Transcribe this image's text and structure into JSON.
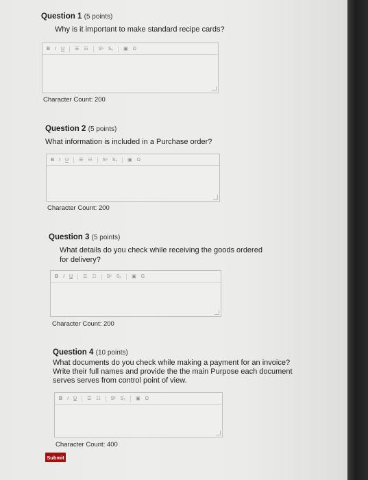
{
  "toolbar": {
    "bold": "B",
    "italic": "I",
    "underline": "U",
    "superscript": "Sˢ",
    "subscript": "S₂",
    "image": "▣",
    "special_char": "Ω"
  },
  "questions": [
    {
      "heading": "Question 1",
      "points": "(5 points)",
      "text": "Why is it important to make standard recipe cards?",
      "count_label": "Character Count: 200"
    },
    {
      "heading": "Question 2",
      "points": "(5 points)",
      "text": "What information is included in a Purchase order?",
      "count_label": "Character Count: 200"
    },
    {
      "heading": "Question 3",
      "points": "(5 points)",
      "text": "What details do you check while receiving the goods ordered for delivery?",
      "count_label": "Character Count: 200"
    },
    {
      "heading": "Question 4",
      "points": "(10 points)",
      "text": "What documents do you check while making a payment for an invoice? Write their full names and provide the the main Purpose each document serves serves from control point of view.",
      "count_label": "Character Count: 400"
    }
  ],
  "submit_label": "Submit"
}
